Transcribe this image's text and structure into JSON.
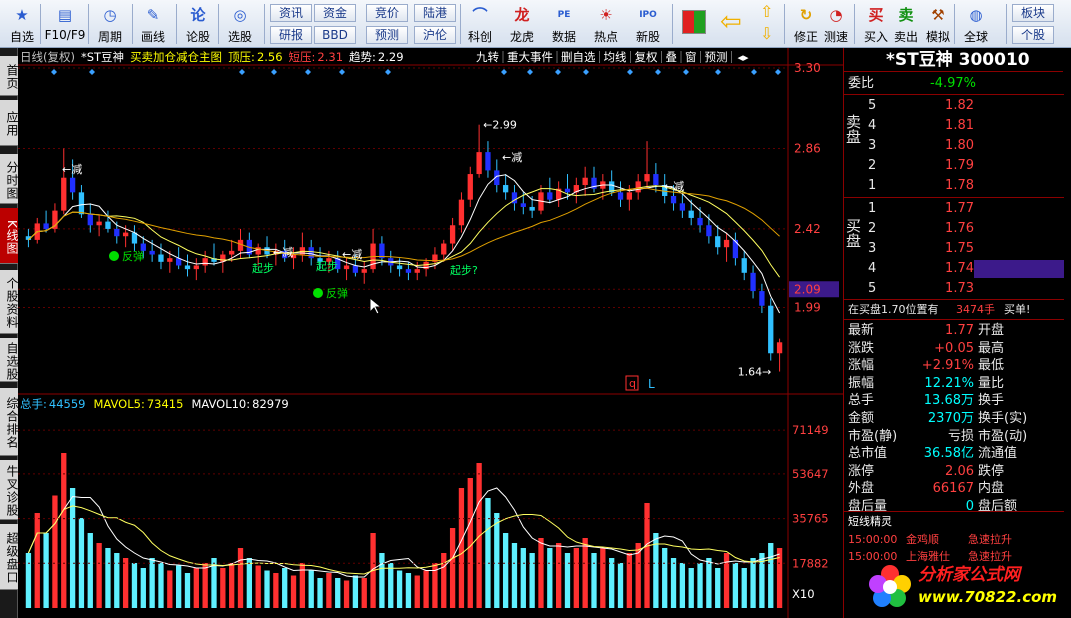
{
  "toolbar": {
    "buttons": [
      {
        "label": "自选",
        "icon": "star-icon"
      },
      {
        "label": "F10/F9",
        "icon": "f10-icon"
      },
      {
        "label": "周期",
        "icon": "clock-icon"
      },
      {
        "label": "画线",
        "icon": "pen-icon"
      },
      {
        "label": "论股",
        "icon": "discuss-icon"
      },
      {
        "label": "选股",
        "icon": "stock-pick-icon"
      },
      {
        "label": "科创",
        "icon": "tech-icon"
      },
      {
        "label": "龙虎",
        "icon": "dragon-tiger-icon"
      },
      {
        "label": "数据",
        "icon": "data-icon"
      },
      {
        "label": "热点",
        "icon": "hot-icon"
      },
      {
        "label": "新股",
        "icon": "ipo-icon"
      },
      {
        "label": "修正",
        "icon": "adjust-icon"
      },
      {
        "label": "测速",
        "icon": "speed-icon"
      },
      {
        "label": "买入",
        "icon": "buy-icon"
      },
      {
        "label": "卖出",
        "icon": "sell-icon"
      },
      {
        "label": "模拟",
        "icon": "simulate-icon"
      },
      {
        "label": "全球",
        "icon": "globe-icon"
      }
    ],
    "small_buttons": [
      "资讯",
      "资金",
      "竞价",
      "陆港",
      "研报",
      "BBD",
      "预测",
      "沪伦",
      "板块",
      "个股"
    ]
  },
  "left_tabs": [
    "首页",
    "应用",
    "分时图",
    "K线图",
    "个股资料",
    "自选股",
    "综合排名",
    "牛叉诊股",
    "超级盘口"
  ],
  "chart_header": {
    "period": "日线(复权)",
    "name": "*ST豆神",
    "indicator": "买卖加仓减仓主图",
    "top_pressure_label": "顶压:",
    "top_pressure": "2.56",
    "short_pressure_label": "短压:",
    "short_pressure": "2.31",
    "trend_label": "趋势:",
    "trend": "2.29"
  },
  "chart_tabs": [
    "九转",
    "重大事件",
    "删自选",
    "均线",
    "复权",
    "叠",
    "窗",
    "预测"
  ],
  "volume_header": {
    "total_label": "总手:",
    "total": "44559",
    "mavol5_label": "MAVOL5:",
    "mavol5": "73415",
    "mavol10_label": "MAVOL10:",
    "mavol10": "82979"
  },
  "annotations": {
    "high_label": "2.99",
    "low_label": "1.64",
    "reduce": "减",
    "rebound": "反弹",
    "start": "起步",
    "start_q": "起步?",
    "q_mark": "q",
    "l_mark": "L"
  },
  "chart_data": {
    "type": "candlestick",
    "price_axis": [
      "3.30",
      "2.86",
      "2.42",
      "2.09",
      "1.99",
      "1.64"
    ],
    "price_ylim": [
      1.55,
      3.3
    ],
    "current_price_tag": "2.09",
    "volume_axis": [
      "71149",
      "53647",
      "35765",
      "17882"
    ],
    "volume_unit": "X10",
    "volume_ylim": [
      0,
      80000
    ],
    "candles": [
      [
        2.38,
        2.42,
        2.32,
        2.36
      ],
      [
        2.36,
        2.48,
        2.34,
        2.45
      ],
      [
        2.45,
        2.52,
        2.4,
        2.42
      ],
      [
        2.42,
        2.56,
        2.4,
        2.52
      ],
      [
        2.52,
        2.86,
        2.5,
        2.7
      ],
      [
        2.7,
        2.8,
        2.58,
        2.62
      ],
      [
        2.62,
        2.66,
        2.48,
        2.5
      ],
      [
        2.5,
        2.56,
        2.4,
        2.44
      ],
      [
        2.44,
        2.5,
        2.38,
        2.46
      ],
      [
        2.46,
        2.52,
        2.4,
        2.42
      ],
      [
        2.42,
        2.46,
        2.34,
        2.38
      ],
      [
        2.38,
        2.44,
        2.32,
        2.4
      ],
      [
        2.4,
        2.44,
        2.3,
        2.34
      ],
      [
        2.34,
        2.38,
        2.26,
        2.3
      ],
      [
        2.3,
        2.36,
        2.24,
        2.28
      ],
      [
        2.28,
        2.34,
        2.2,
        2.24
      ],
      [
        2.24,
        2.3,
        2.18,
        2.26
      ],
      [
        2.26,
        2.32,
        2.2,
        2.22
      ],
      [
        2.22,
        2.28,
        2.16,
        2.2
      ],
      [
        2.2,
        2.26,
        2.14,
        2.22
      ],
      [
        2.22,
        2.3,
        2.18,
        2.26
      ],
      [
        2.26,
        2.34,
        2.22,
        2.24
      ],
      [
        2.24,
        2.3,
        2.18,
        2.28
      ],
      [
        2.28,
        2.36,
        2.24,
        2.3
      ],
      [
        2.3,
        2.42,
        2.26,
        2.36
      ],
      [
        2.36,
        2.4,
        2.26,
        2.28
      ],
      [
        2.28,
        2.34,
        2.22,
        2.32
      ],
      [
        2.32,
        2.38,
        2.26,
        2.28
      ],
      [
        2.28,
        2.34,
        2.22,
        2.3
      ],
      [
        2.3,
        2.36,
        2.24,
        2.26
      ],
      [
        2.26,
        2.32,
        2.2,
        2.28
      ],
      [
        2.28,
        2.4,
        2.24,
        2.32
      ],
      [
        2.32,
        2.36,
        2.22,
        2.26
      ],
      [
        2.26,
        2.32,
        2.2,
        2.24
      ],
      [
        2.24,
        2.3,
        2.18,
        2.26
      ],
      [
        2.26,
        2.3,
        2.18,
        2.2
      ],
      [
        2.2,
        2.26,
        2.14,
        2.22
      ],
      [
        2.22,
        2.28,
        2.16,
        2.18
      ],
      [
        2.18,
        2.24,
        2.12,
        2.2
      ],
      [
        2.2,
        2.42,
        2.18,
        2.34
      ],
      [
        2.34,
        2.38,
        2.22,
        2.26
      ],
      [
        2.26,
        2.3,
        2.18,
        2.22
      ],
      [
        2.22,
        2.26,
        2.16,
        2.2
      ],
      [
        2.2,
        2.24,
        2.14,
        2.18
      ],
      [
        2.18,
        2.24,
        2.14,
        2.2
      ],
      [
        2.2,
        2.26,
        2.16,
        2.24
      ],
      [
        2.24,
        2.32,
        2.2,
        2.28
      ],
      [
        2.28,
        2.36,
        2.24,
        2.34
      ],
      [
        2.34,
        2.48,
        2.3,
        2.44
      ],
      [
        2.44,
        2.62,
        2.4,
        2.58
      ],
      [
        2.58,
        2.76,
        2.54,
        2.72
      ],
      [
        2.72,
        2.99,
        2.7,
        2.84
      ],
      [
        2.84,
        2.9,
        2.7,
        2.74
      ],
      [
        2.74,
        2.8,
        2.62,
        2.66
      ],
      [
        2.66,
        2.72,
        2.58,
        2.62
      ],
      [
        2.62,
        2.66,
        2.52,
        2.56
      ],
      [
        2.56,
        2.62,
        2.5,
        2.54
      ],
      [
        2.54,
        2.6,
        2.48,
        2.52
      ],
      [
        2.52,
        2.66,
        2.5,
        2.62
      ],
      [
        2.62,
        2.7,
        2.56,
        2.58
      ],
      [
        2.58,
        2.68,
        2.54,
        2.64
      ],
      [
        2.64,
        2.72,
        2.58,
        2.62
      ],
      [
        2.62,
        2.7,
        2.56,
        2.66
      ],
      [
        2.66,
        2.76,
        2.6,
        2.7
      ],
      [
        2.7,
        2.76,
        2.62,
        2.64
      ],
      [
        2.64,
        2.72,
        2.58,
        2.68
      ],
      [
        2.68,
        2.74,
        2.6,
        2.62
      ],
      [
        2.62,
        2.68,
        2.54,
        2.58
      ],
      [
        2.58,
        2.66,
        2.52,
        2.62
      ],
      [
        2.62,
        2.72,
        2.58,
        2.68
      ],
      [
        2.68,
        2.9,
        2.64,
        2.72
      ],
      [
        2.72,
        2.78,
        2.62,
        2.66
      ],
      [
        2.66,
        2.72,
        2.56,
        2.6
      ],
      [
        2.6,
        2.66,
        2.52,
        2.56
      ],
      [
        2.56,
        2.62,
        2.48,
        2.52
      ],
      [
        2.52,
        2.58,
        2.44,
        2.48
      ],
      [
        2.48,
        2.54,
        2.4,
        2.44
      ],
      [
        2.44,
        2.5,
        2.34,
        2.38
      ],
      [
        2.38,
        2.44,
        2.28,
        2.32
      ],
      [
        2.32,
        2.4,
        2.24,
        2.36
      ],
      [
        2.36,
        2.4,
        2.22,
        2.26
      ],
      [
        2.26,
        2.3,
        2.14,
        2.18
      ],
      [
        2.18,
        2.22,
        2.04,
        2.08
      ],
      [
        2.08,
        2.12,
        1.96,
        2.0
      ],
      [
        2.0,
        2.04,
        1.7,
        1.74
      ],
      [
        1.74,
        1.82,
        1.64,
        1.8
      ]
    ],
    "volumes": [
      22000,
      38000,
      30000,
      45000,
      62000,
      48000,
      36000,
      30000,
      26000,
      24000,
      22000,
      20000,
      18000,
      16000,
      20000,
      18000,
      15000,
      17000,
      14000,
      16000,
      18000,
      20000,
      16000,
      18000,
      24000,
      20000,
      17000,
      15000,
      14000,
      16000,
      13000,
      18000,
      15000,
      12000,
      14000,
      12000,
      11000,
      13000,
      12000,
      30000,
      22000,
      18000,
      15000,
      14000,
      13000,
      15000,
      18000,
      22000,
      32000,
      48000,
      52000,
      58000,
      44000,
      38000,
      30000,
      26000,
      24000,
      22000,
      28000,
      24000,
      26000,
      22000,
      24000,
      28000,
      22000,
      24000,
      20000,
      18000,
      22000,
      26000,
      42000,
      30000,
      24000,
      20000,
      18000,
      16000,
      18000,
      20000,
      16000,
      22000,
      18000,
      16000,
      20000,
      22000,
      26000,
      24000
    ]
  },
  "quote": {
    "title": "*ST豆神  300010",
    "weibi_label": "委比",
    "weibi": "-4.97%",
    "sell_side": "卖盘",
    "buy_side": "买盘",
    "asks": [
      {
        "level": "5",
        "price": "1.82"
      },
      {
        "level": "4",
        "price": "1.81"
      },
      {
        "level": "3",
        "price": "1.80"
      },
      {
        "level": "2",
        "price": "1.79"
      },
      {
        "level": "1",
        "price": "1.78"
      }
    ],
    "bids": [
      {
        "level": "1",
        "price": "1.77"
      },
      {
        "level": "2",
        "price": "1.76"
      },
      {
        "level": "3",
        "price": "1.75"
      },
      {
        "level": "4",
        "price": "1.74"
      },
      {
        "level": "5",
        "price": "1.73"
      }
    ],
    "trade_note": "在买盘1.70位置有",
    "trade_qty": "3474手",
    "trade_tag": "买单!",
    "stats": [
      {
        "l": "最新",
        "v": "1.77",
        "c": "red",
        "r": "开盘"
      },
      {
        "l": "涨跌",
        "v": "+0.05",
        "c": "red",
        "r": "最高"
      },
      {
        "l": "涨幅",
        "v": "+2.91%",
        "c": "red",
        "r": "最低"
      },
      {
        "l": "振幅",
        "v": "12.21%",
        "c": "cyan",
        "r": "量比"
      },
      {
        "l": "总手",
        "v": "13.68万",
        "c": "cyan",
        "r": "换手"
      },
      {
        "l": "金额",
        "v": "2370万",
        "c": "cyan",
        "r": "换手(实)"
      },
      {
        "l": "市盈(静)",
        "v": "亏损",
        "c": "white",
        "r": "市盈(动)"
      },
      {
        "l": "总市值",
        "v": "36.58亿",
        "c": "cyan",
        "r": "流通值"
      },
      {
        "l": "涨停",
        "v": "2.06",
        "c": "red",
        "r": "跌停"
      },
      {
        "l": "外盘",
        "v": "66167",
        "c": "red",
        "r": "内盘"
      },
      {
        "l": "盘后量",
        "v": "0",
        "c": "cyan",
        "r": "盘后额"
      }
    ],
    "news_title": "短线精灵",
    "news": [
      {
        "time": "15:00:00",
        "name": "金鸡顺",
        "event": "急速拉升"
      },
      {
        "time": "15:00:00",
        "name": "上海雅仕",
        "event": "急速拉升"
      }
    ]
  },
  "watermark": {
    "line1": "分析家公式网",
    "line2": "www.70822.com"
  }
}
